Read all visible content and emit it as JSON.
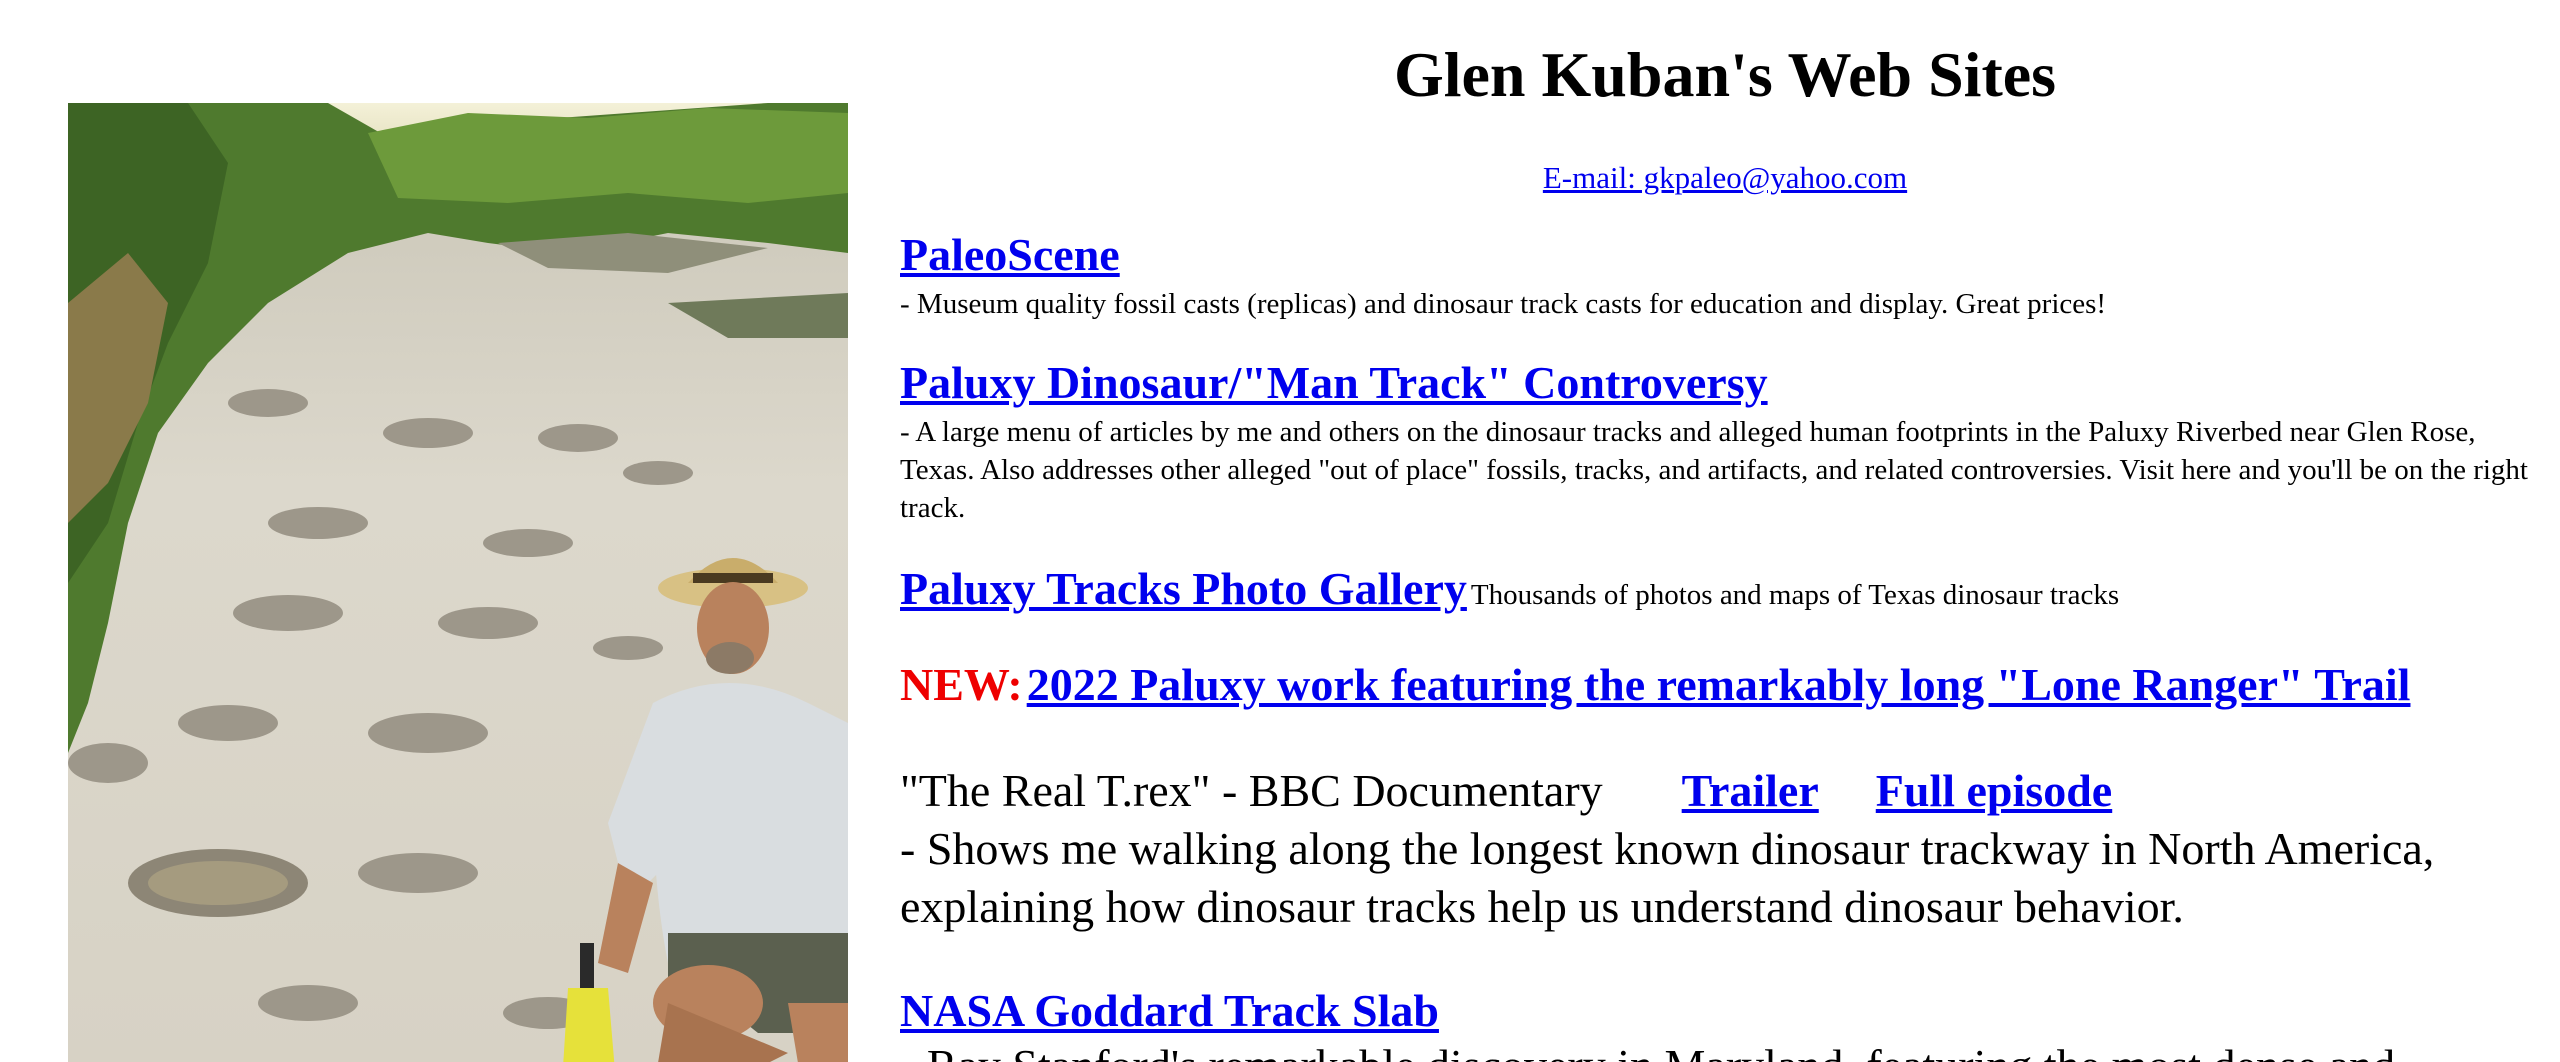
{
  "header": {
    "title": "Glen Kuban's Web Sites",
    "email_link": "E-mail: gkpaleo@yahoo.com"
  },
  "photo": {
    "icon": "photo-of-man-with-dinosaur-tracks"
  },
  "sites": {
    "paleoscene": {
      "link": "PaleoScene",
      "desc": "- Museum quality fossil casts (replicas) and dinosaur track casts for education and display. Great prices!"
    },
    "paluxy_controversy": {
      "link": "Paluxy Dinosaur/\"Man Track\" Controversy",
      "desc": "- A large menu of articles by me and others on the dinosaur tracks and alleged human footprints in the Paluxy Riverbed near Glen Rose, Texas. Also addresses other alleged \"out of place\" fossils, tracks, and artifacts, and related controversies. Visit here and you'll be on the right track."
    },
    "photo_gallery": {
      "link": "Paluxy Tracks Photo Gallery",
      "desc": "Thousands of photos and maps of Texas dinosaur tracks"
    },
    "new_item": {
      "label": "NEW:",
      "link": "2022 Paluxy work featuring the remarkably long \"Lone Ranger\" Trail"
    },
    "bbc": {
      "title": "\"The Real T.rex\" - BBC Documentary",
      "trailer_link": "Trailer",
      "full_link": "Full episode",
      "desc": "- Shows me walking along the longest known dinosaur trackway in North America, explaining how dinosaur tracks help us understand dinosaur behavior."
    },
    "nasa": {
      "link": "NASA Goddard Track Slab",
      "desc": "- Ray Stanford's remarkable discovery in Maryland, featuring the most dense and"
    }
  },
  "colors": {
    "link": "#0000ee",
    "new_label": "#ee0000"
  }
}
